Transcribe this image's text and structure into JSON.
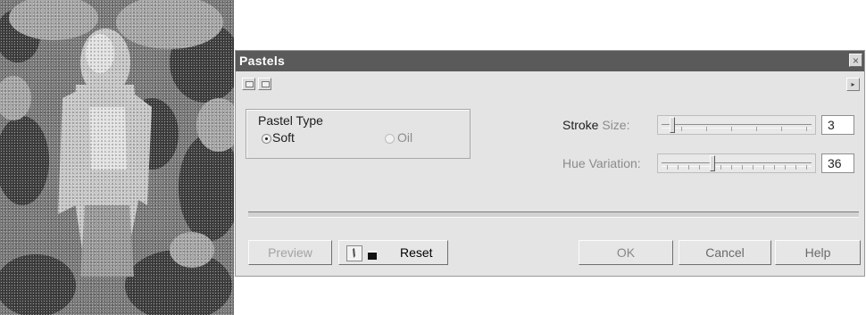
{
  "dialog": {
    "title": "Pastels",
    "close_symbol": "×",
    "toolbar": {
      "left_icons": [
        "single-view-icon",
        "dual-view-icon"
      ],
      "right_icon": "flyout-arrow-icon",
      "right_symbol": "▸"
    },
    "pastel_type": {
      "label": "Pastel Type",
      "options": [
        {
          "label": "Soft",
          "selected": true,
          "enabled": true
        },
        {
          "label": "Oil",
          "selected": false,
          "enabled": false
        }
      ]
    },
    "stroke_size": {
      "label_dark": "Stroke",
      "label_light": "Size:",
      "value": "3"
    },
    "hue_variation": {
      "label": "Hue Variation:",
      "value": "36"
    },
    "buttons": {
      "preview": "Preview",
      "reset": "Reset",
      "ok": "OK",
      "cancel": "Cancel",
      "help": "Help"
    },
    "reset_icon": "lock-preview-icon"
  },
  "colors": {
    "title_bar": "#5a5a5a",
    "dialog_bg": "#e4e4e4",
    "disabled_text": "#8d8d8d"
  }
}
